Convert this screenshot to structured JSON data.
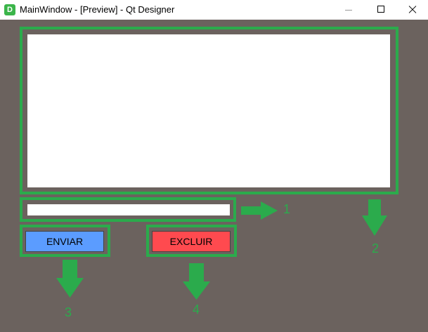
{
  "window": {
    "icon_letter": "D",
    "title": "MainWindow - [Preview] - Qt Designer"
  },
  "form": {
    "text_area_value": "",
    "line_edit_value": "",
    "send_button": "ENVIAR",
    "delete_button": "EXCLUIR"
  },
  "annotations": {
    "label_1": "1",
    "label_2": "2",
    "label_3": "3",
    "label_4": "4"
  },
  "colors": {
    "background": "#6b625e",
    "highlight_green": "#2bab4c",
    "send_button": "#5b9cff",
    "delete_button": "#ff4a4f"
  }
}
